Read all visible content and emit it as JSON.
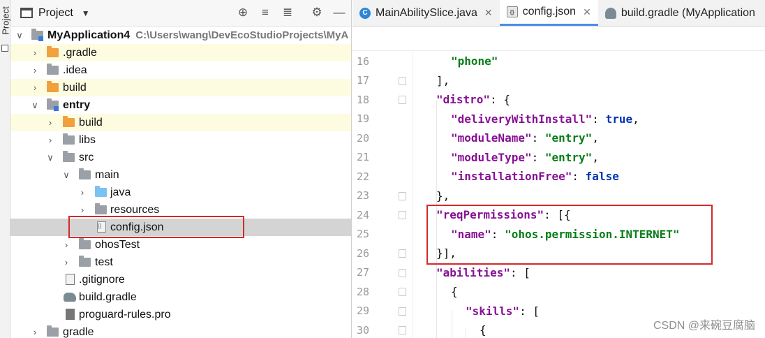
{
  "toolstrip": {
    "label": "Project"
  },
  "project_panel": {
    "title": "Project",
    "toolbar_icons": [
      "target-icon",
      "collapse-all-icon",
      "expand-all-icon",
      "gear-icon",
      "minimize-icon"
    ],
    "tree": [
      {
        "label": "MyApplication4",
        "path": "C:\\Users\\wang\\DevEcoStudioProjects\\MyA"
      },
      {
        "label": ".gradle"
      },
      {
        "label": ".idea"
      },
      {
        "label": "build"
      },
      {
        "label": "entry"
      },
      {
        "label": "build"
      },
      {
        "label": "libs"
      },
      {
        "label": "src"
      },
      {
        "label": "main"
      },
      {
        "label": "java"
      },
      {
        "label": "resources"
      },
      {
        "label": "config.json"
      },
      {
        "label": "ohosTest"
      },
      {
        "label": "test"
      },
      {
        "label": ".gitignore"
      },
      {
        "label": "build.gradle"
      },
      {
        "label": "proguard-rules.pro"
      },
      {
        "label": "gradle"
      }
    ]
  },
  "editor": {
    "tabs": [
      {
        "label": "MainAbilitySlice.java",
        "icon": "java-class-icon",
        "active": false
      },
      {
        "label": "config.json",
        "icon": "json-file-icon",
        "active": true
      },
      {
        "label": "build.gradle (MyApplication",
        "icon": "gradle-icon",
        "active": false
      }
    ],
    "line_numbers": [
      "16",
      "17",
      "18",
      "19",
      "20",
      "21",
      "22",
      "23",
      "24",
      "25",
      "26",
      "27",
      "28",
      "29",
      "30"
    ],
    "lines": [
      "\"phone\"",
      "],",
      "\"distro\": {",
      "\"deliveryWithInstall\": true,",
      "\"moduleName\": \"entry\",",
      "\"moduleType\": \"entry\",",
      "\"installationFree\": false",
      "},",
      "\"reqPermissions\": [{",
      "\"name\": \"ohos.permission.INTERNET\"",
      "}],",
      "\"abilities\": [",
      "{",
      "\"skills\": [",
      "{"
    ]
  },
  "colors": {
    "highlight_row": "#fefce0",
    "selected_row": "#d4d4d4",
    "red_annotation": "#d42a2a",
    "json_key": "#871094",
    "json_string": "#067d17",
    "json_keyword": "#0033b3"
  },
  "watermark": "CSDN @来碗豆腐脑"
}
